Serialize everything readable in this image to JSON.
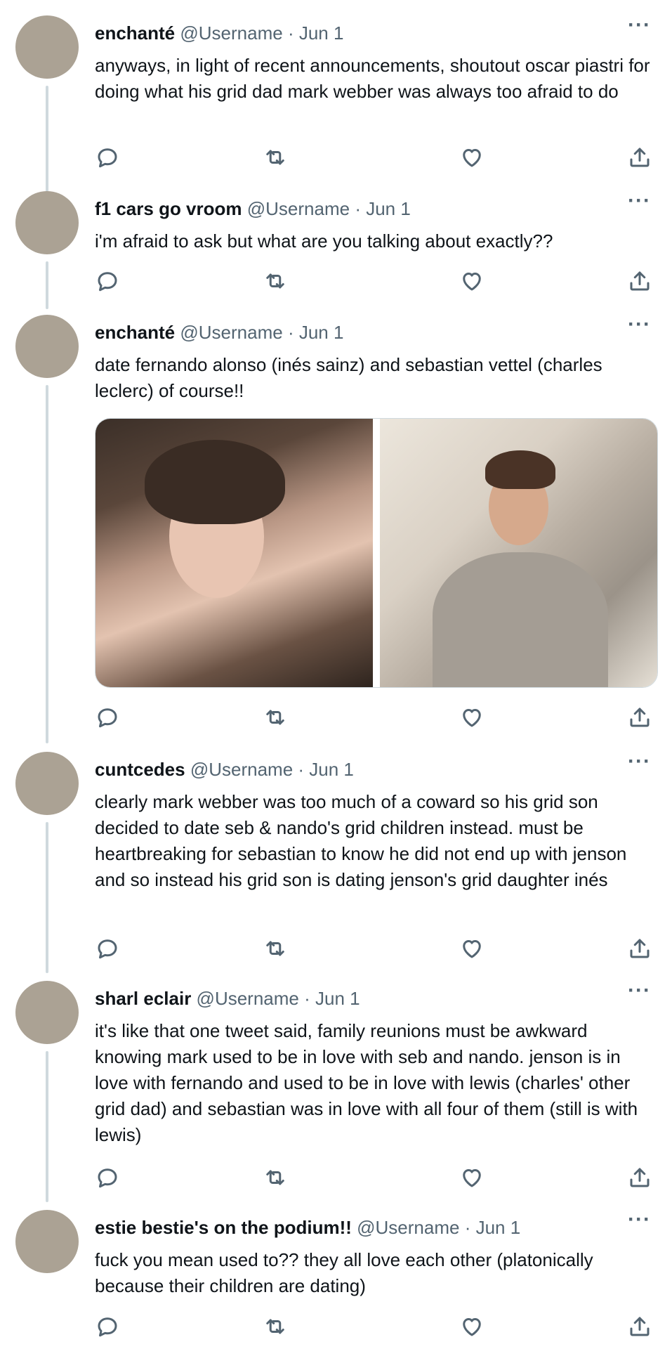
{
  "tweets": [
    {
      "name": "enchanté",
      "handle": "@Username",
      "date": "· Jun 1",
      "text": "anyways, in light of recent announcements, shoutout oscar piastri for doing what his grid dad mark webber was always too afraid to do"
    },
    {
      "name": "f1 cars go vroom",
      "handle": "@Username",
      "date": "· Jun 1",
      "text": "i'm afraid to ask but what are you talking about exactly??"
    },
    {
      "name": "enchanté",
      "handle": "@Username",
      "date": "· Jun 1",
      "text": "date fernando  alonso (inés sainz) and sebastian vettel (charles leclerc) of course!!"
    },
    {
      "name": "cuntcedes",
      "handle": "@Username",
      "date": "· Jun 1",
      "text": "clearly mark webber was too much of a coward so his grid son decided to date seb & nando's grid children instead. must be heartbreaking for sebastian to know he did not end up with jenson and so instead his grid son is dating jenson's grid daughter inés"
    },
    {
      "name": "sharl eclair",
      "handle": "@Username",
      "date": "· Jun 1",
      "text": "it's like that one tweet said, family reunions must be awkward knowing mark used to be in love with seb and nando. jenson is in love with fernando and used to be in love with lewis (charles' other grid dad) and sebastian was in love with all four of them (still is with lewis)"
    },
    {
      "name": "estie bestie's on the podium!!",
      "handle": "@Username",
      "date": "· Jun 1",
      "text": "fuck you mean used to?? they all love each other (platonically because their children are dating)"
    }
  ],
  "more_label": "···",
  "icons": [
    "reply-icon",
    "retweet-icon",
    "like-icon",
    "share-icon"
  ],
  "colors": {
    "avatar": "#aba294",
    "thread_line": "#cfd9de",
    "meta": "#536471",
    "text": "#0f1419"
  }
}
